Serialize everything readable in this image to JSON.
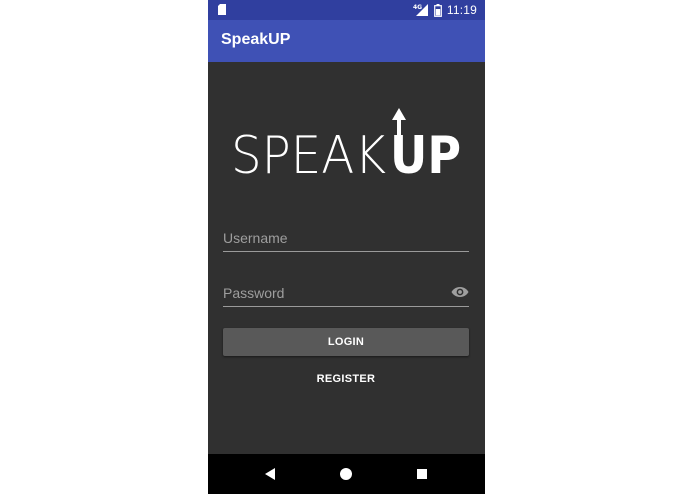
{
  "status_bar": {
    "time": "11:19",
    "network_label": "4G",
    "icons": [
      "sd-card-icon",
      "signal-icon",
      "battery-icon"
    ]
  },
  "app_bar": {
    "title": "SpeakUP"
  },
  "logo": {
    "text_light": "SPEAK",
    "text_bold": "UP"
  },
  "form": {
    "username_placeholder": "Username",
    "password_placeholder": "Password",
    "login_label": "LOGIN",
    "register_label": "REGISTER"
  },
  "nav_bar": {
    "icons": [
      "back-icon",
      "home-icon",
      "recents-icon"
    ]
  },
  "colors": {
    "status_bar": "#303F9F",
    "app_bar": "#3F51B5",
    "background": "#303030",
    "login_button": "#595959",
    "nav_bar": "#000000"
  }
}
